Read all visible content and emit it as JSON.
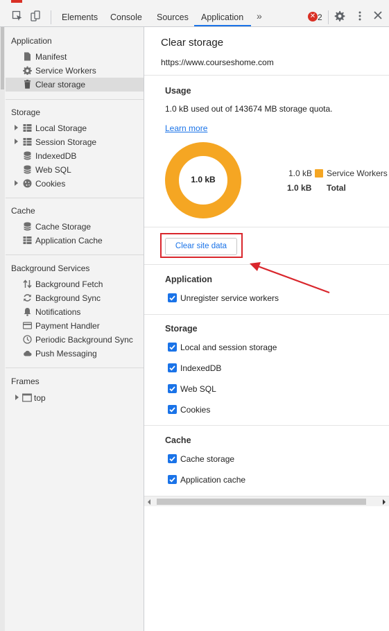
{
  "toolbar": {
    "tabs": [
      "Elements",
      "Console",
      "Sources",
      "Application"
    ],
    "more_tabs": "»",
    "error_count": "2",
    "accent": "#1a73e8",
    "error_color": "#d93025"
  },
  "sidebar": {
    "sections": [
      {
        "title": "Application",
        "items": [
          "Manifest",
          "Service Workers",
          "Clear storage"
        ]
      },
      {
        "title": "Storage",
        "items": [
          "Local Storage",
          "Session Storage",
          "IndexedDB",
          "Web SQL",
          "Cookies"
        ]
      },
      {
        "title": "Cache",
        "items": [
          "Cache Storage",
          "Application Cache"
        ]
      },
      {
        "title": "Background Services",
        "items": [
          "Background Fetch",
          "Background Sync",
          "Notifications",
          "Payment Handler",
          "Periodic Background Sync",
          "Push Messaging"
        ]
      },
      {
        "title": "Frames",
        "items": [
          "top"
        ]
      }
    ],
    "selected": "Clear storage"
  },
  "main": {
    "title": "Clear storage",
    "url": "https://www.courseshome.com",
    "usage": {
      "heading": "Usage",
      "quota_text": "1.0 kB used out of 143674 MB storage quota.",
      "learn_more": "Learn more",
      "donut_label": "1.0 kB",
      "donut_color": "#f5a623",
      "legend": [
        {
          "value": "1.0 kB",
          "name": "Service Workers"
        },
        {
          "value": "1.0 kB",
          "name": "Total"
        }
      ]
    },
    "clear_button": "Clear site data",
    "groups": [
      {
        "heading": "Application",
        "options": [
          {
            "label": "Unregister service workers",
            "checked": true
          }
        ]
      },
      {
        "heading": "Storage",
        "options": [
          {
            "label": "Local and session storage",
            "checked": true
          },
          {
            "label": "IndexedDB",
            "checked": true
          },
          {
            "label": "Web SQL",
            "checked": true
          },
          {
            "label": "Cookies",
            "checked": true
          }
        ]
      },
      {
        "heading": "Cache",
        "options": [
          {
            "label": "Cache storage",
            "checked": true
          },
          {
            "label": "Application cache",
            "checked": true
          }
        ]
      }
    ]
  },
  "annotation": {
    "highlight_color": "#d9262c"
  }
}
